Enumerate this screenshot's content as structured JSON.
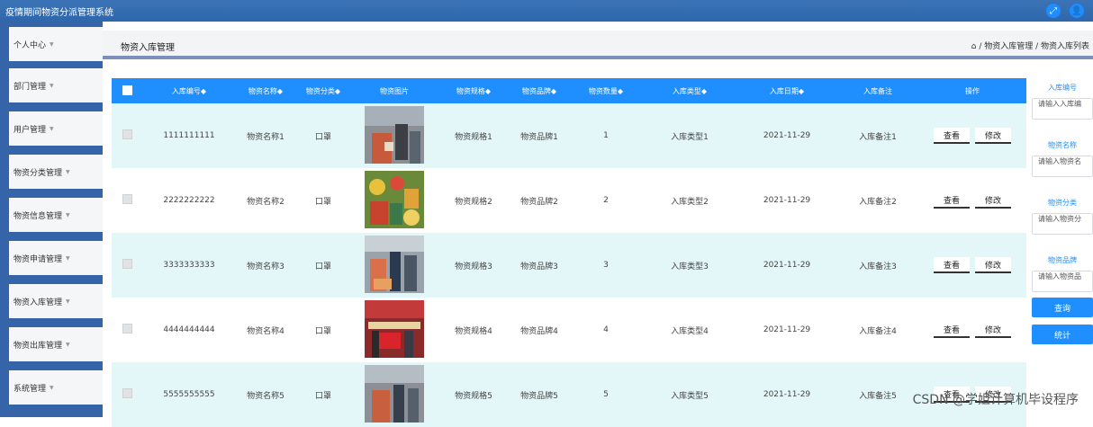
{
  "app_title": "疫情期间物资分派管理系统",
  "top_icons": {
    "fullscreen": "⤢",
    "user": "👤"
  },
  "sidebar": {
    "items": [
      {
        "label": "个人中心"
      },
      {
        "label": "部门管理"
      },
      {
        "label": "用户管理"
      },
      {
        "label": "物资分类管理"
      },
      {
        "label": "物资信息管理"
      },
      {
        "label": "物资申请管理"
      },
      {
        "label": "物资入库管理"
      },
      {
        "label": "物资出库管理"
      },
      {
        "label": "系统管理"
      }
    ]
  },
  "header": {
    "title": "物资入库管理",
    "breadcrumb": "/ 物资入库管理 / 物资入库列表"
  },
  "table": {
    "columns": [
      "入库编号◆",
      "物资名称◆",
      "物资分类◆",
      "物资图片",
      "物资规格◆",
      "物资品牌◆",
      "物资数量◆",
      "入库类型◆",
      "入库日期◆",
      "入库备注",
      "操作"
    ],
    "rows": [
      {
        "code": "1111111111",
        "name": "物资名称1",
        "category": "口罩",
        "spec": "物资规格1",
        "brand": "物资品牌1",
        "qty": "1",
        "type": "入库类型1",
        "date": "2021-11-29",
        "note": "入库备注1"
      },
      {
        "code": "2222222222",
        "name": "物资名称2",
        "category": "口罩",
        "spec": "物资规格2",
        "brand": "物资品牌2",
        "qty": "2",
        "type": "入库类型2",
        "date": "2021-11-29",
        "note": "入库备注2"
      },
      {
        "code": "3333333333",
        "name": "物资名称3",
        "category": "口罩",
        "spec": "物资规格3",
        "brand": "物资品牌3",
        "qty": "3",
        "type": "入库类型3",
        "date": "2021-11-29",
        "note": "入库备注3"
      },
      {
        "code": "4444444444",
        "name": "物资名称4",
        "category": "口罩",
        "spec": "物资规格4",
        "brand": "物资品牌4",
        "qty": "4",
        "type": "入库类型4",
        "date": "2021-11-29",
        "note": "入库备注4"
      },
      {
        "code": "5555555555",
        "name": "物资名称5",
        "category": "口罩",
        "spec": "物资规格5",
        "brand": "物资品牌5",
        "qty": "5",
        "type": "入库类型5",
        "date": "2021-11-29",
        "note": "入库备注5"
      }
    ],
    "view_label": "查看",
    "edit_label": "修改"
  },
  "filters": {
    "fields": [
      {
        "label": "入库编号",
        "placeholder": "请输入入库编"
      },
      {
        "label": "物资名称",
        "placeholder": "请输入物资名"
      },
      {
        "label": "物资分类",
        "placeholder": "请输入物资分"
      },
      {
        "label": "物资品牌",
        "placeholder": "请输入物资品"
      }
    ],
    "search_label": "查询",
    "stats_label": "统计"
  },
  "watermark": "CSDN @学姐计算机毕设程序",
  "colors": {
    "topbar": "#2f67ad",
    "sidebar": "#3564a8",
    "accent": "#1f8fff",
    "row_alt": "#e3f6f8"
  }
}
